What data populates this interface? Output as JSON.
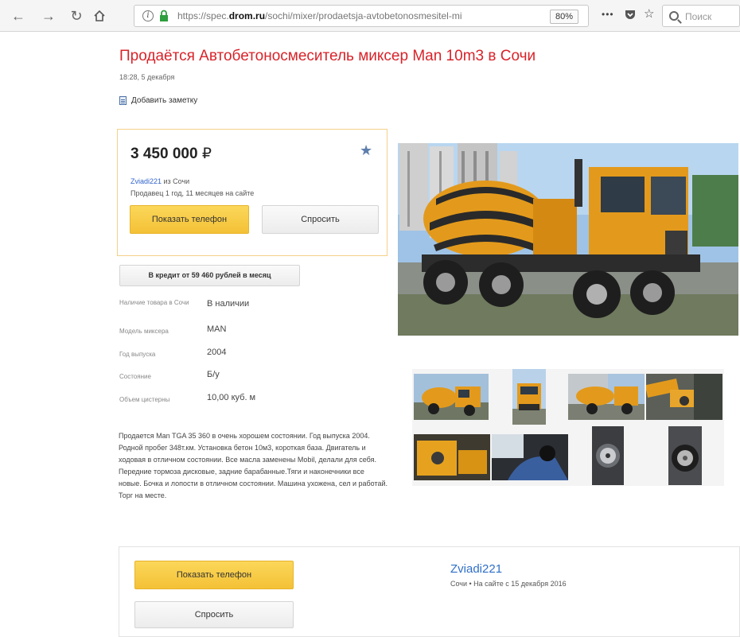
{
  "browser": {
    "url_prefix": "https://spec.",
    "url_domain": "drom.ru",
    "url_path": "/sochi/mixer/prodaetsja-avtobetonosmesitel-mi",
    "zoom": "80%",
    "search_placeholder": "Поиск",
    "more_label": "•••"
  },
  "listing": {
    "title": "Продаётся Автобетоносмеситель миксер Man 10m3 в Сочи",
    "date": "18:28, 5 декабря",
    "add_note": "Добавить заметку",
    "price": "3 450 000",
    "currency": "₽",
    "seller_name": "Zviadi221",
    "seller_city": " из Сочи",
    "seller_since": "Продавец 1 год, 11 месяцев на сайте",
    "show_phone": "Показать телефон",
    "ask": "Спросить",
    "credit": "В кредит от 59 460 рублей в месяц",
    "specs": [
      {
        "label": "Наличие товара в Сочи",
        "value": "В наличии"
      },
      {
        "label": "Модель миксера",
        "value": "MAN"
      },
      {
        "label": "Год выпуска",
        "value": "2004"
      },
      {
        "label": "Состояние",
        "value": "Б/у"
      },
      {
        "label": "Объем цистерны",
        "value": "10,00 куб. м"
      }
    ],
    "description": "Продается Man TGA 35 360 в очень хорошем состоянии. Год выпуска 2004. Родной пробег 348т.км. Установка бетон 10м3, короткая база. Двигатель и ходовая в отличном состоянии. Все масла заменены Mobil, делали для себя. Передние тормоза дисковые, задние барабанные.Тяги и наконечники все новые. Бочка и лопости в отличном состоянии. Машина ухожена, сел и работай. Торг на месте."
  },
  "contact": {
    "show_phone": "Показать телефон",
    "ask": "Спросить",
    "name": "Zviadi221",
    "info": "Сочи •  На сайте с 15 декабря 2016"
  },
  "colors": {
    "title_red": "#d8232a",
    "button_yellow": "#f4c136",
    "link_blue": "#3366cc",
    "star_blue": "#5e7fad",
    "truck_orange": "#e39a1c"
  }
}
